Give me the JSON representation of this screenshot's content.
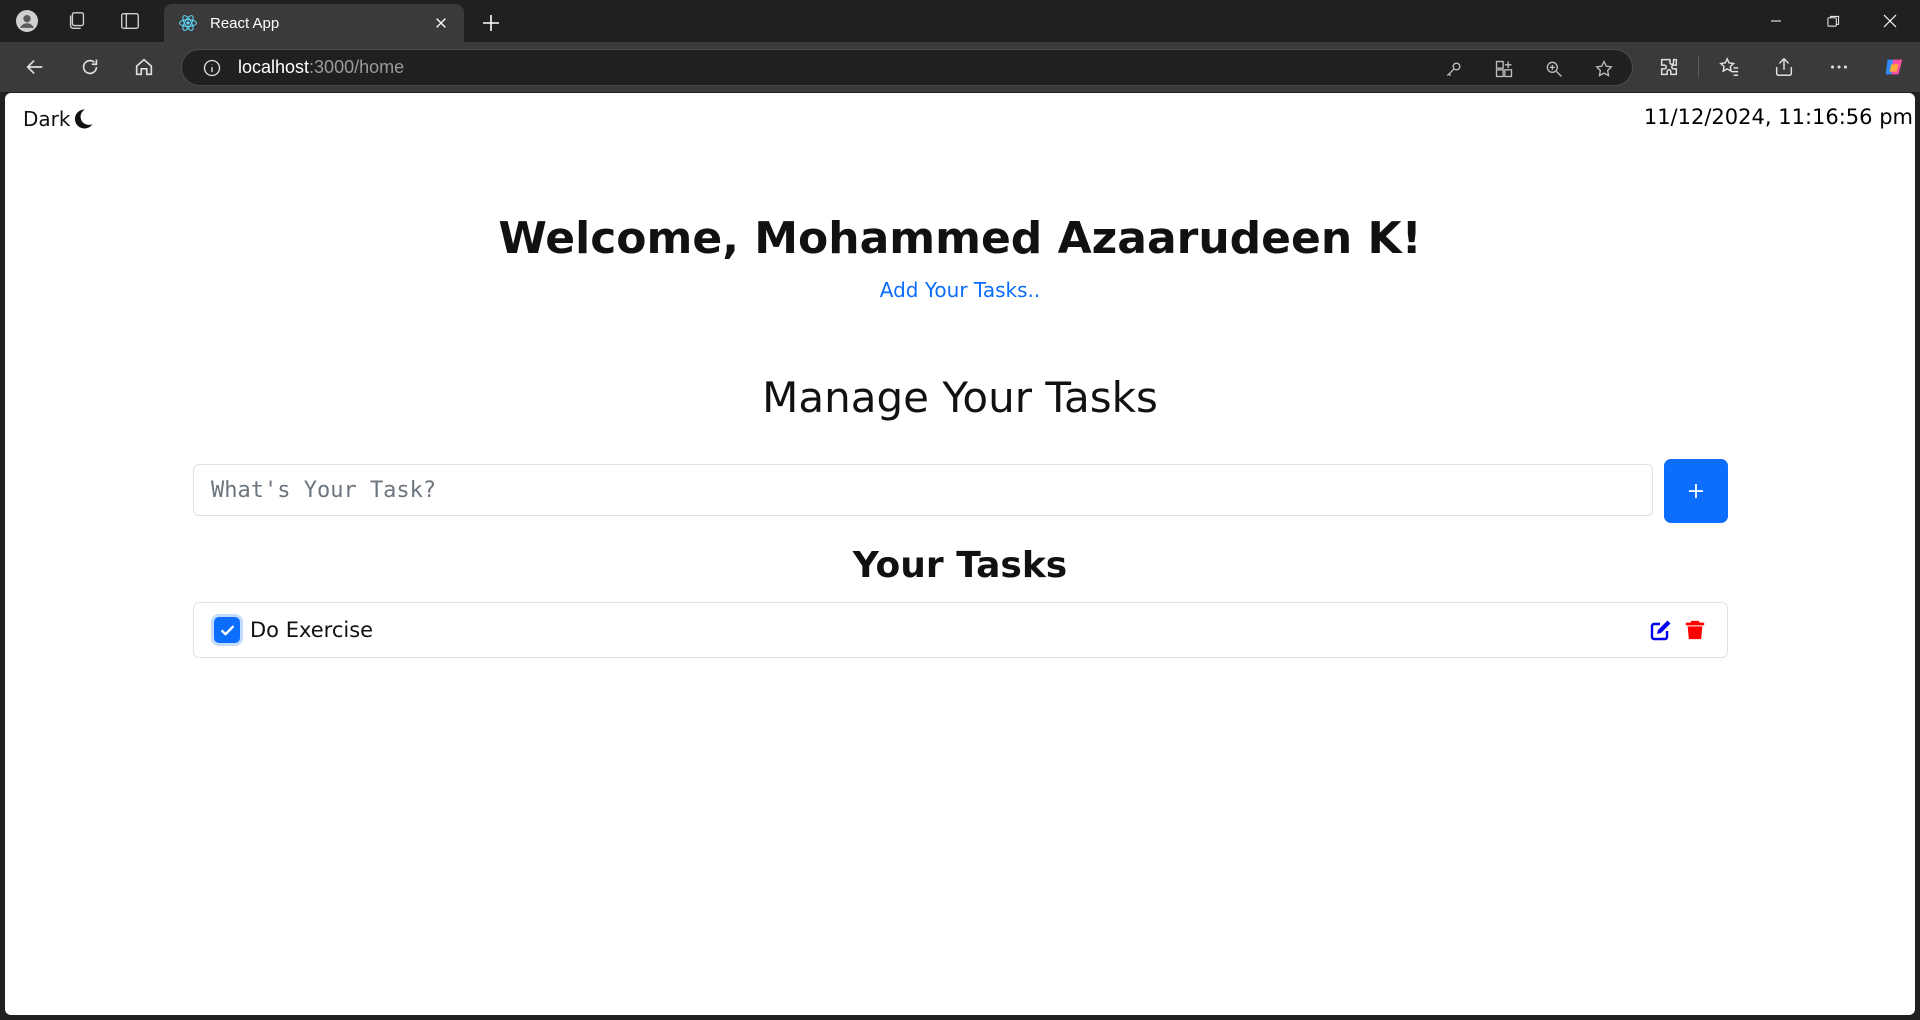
{
  "browser": {
    "tab_title": "React App",
    "url_host": "localhost",
    "url_path": ":3000/home",
    "icons": [
      "profile-icon",
      "workspaces-icon",
      "tab-actions-icon",
      "react-favicon",
      "tab-close-icon",
      "new-tab-icon",
      "minimize-icon",
      "restore-icon",
      "window-close-icon",
      "back-icon",
      "refresh-icon",
      "home-icon",
      "site-info-icon",
      "key-icon",
      "app-available-icon",
      "zoom-icon",
      "favorite-star-icon",
      "extensions-icon",
      "favorites-icon",
      "share-icon",
      "more-icon",
      "copilot-icon"
    ]
  },
  "page": {
    "mode_label": "Dark",
    "clock": "11/12/2024, 11:16:56 pm",
    "welcome": "Welcome, Mohammed Azaarudeen K!",
    "add_link": "Add Your Tasks..",
    "manage_title": "Manage Your Tasks",
    "input_placeholder": "What's Your Task?",
    "input_value": "",
    "add_button_label": "+",
    "tasks_title": "Your Tasks",
    "tasks": [
      {
        "text": "Do Exercise",
        "checked": true
      }
    ]
  },
  "colors": {
    "accent": "#0d6efd",
    "edit_icon": "#0000ee",
    "delete_icon": "#ff0000"
  }
}
